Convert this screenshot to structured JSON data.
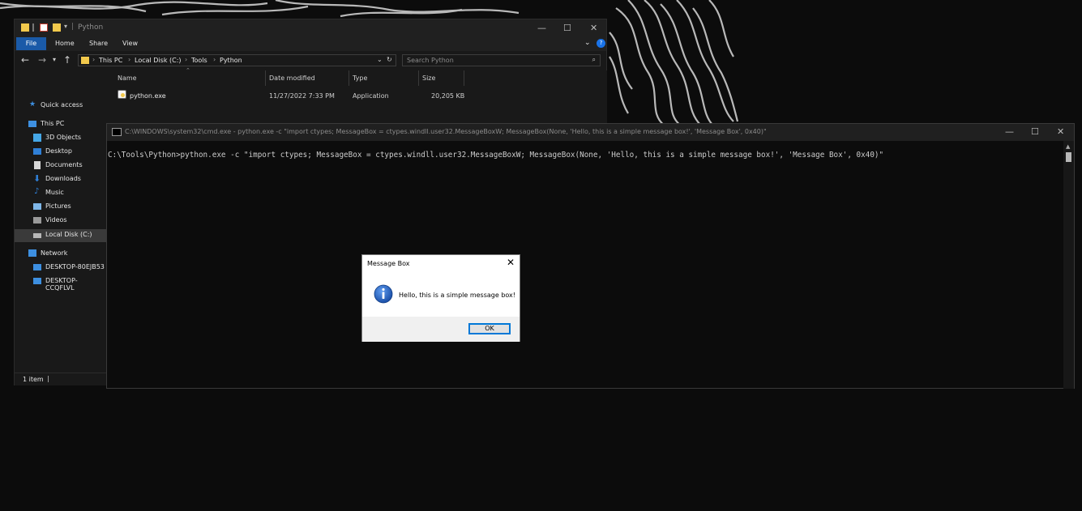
{
  "explorer": {
    "title": "Python",
    "ribbon_tabs": [
      "File",
      "Home",
      "Share",
      "View"
    ],
    "breadcrumbs": [
      "This PC",
      "Local Disk (C:)",
      "Tools",
      "Python"
    ],
    "search_placeholder": "Search Python",
    "nav": {
      "quick_access": "Quick access",
      "this_pc": "This PC",
      "objects3d": "3D Objects",
      "desktop": "Desktop",
      "documents": "Documents",
      "downloads": "Downloads",
      "music": "Music",
      "pictures": "Pictures",
      "videos": "Videos",
      "local_disk": "Local Disk (C:)",
      "network": "Network",
      "pc1": "DESKTOP-80EJB53",
      "pc2": "DESKTOP-CCQFLVL"
    },
    "columns": [
      "Name",
      "Date modified",
      "Type",
      "Size"
    ],
    "files": [
      {
        "name": "python.exe",
        "date": "11/27/2022 7:33 PM",
        "type": "Application",
        "size": "20,205 KB"
      }
    ],
    "status": "1 item"
  },
  "cmd": {
    "title": "C:\\WINDOWS\\system32\\cmd.exe - python.exe  -c \"import ctypes; MessageBox = ctypes.windll.user32.MessageBoxW; MessageBox(None, 'Hello, this is a simple message box!', 'Message Box', 0x40)\"",
    "line": "C:\\Tools\\Python>python.exe -c \"import ctypes; MessageBox = ctypes.windll.user32.MessageBoxW; MessageBox(None, 'Hello, this is a simple message box!', 'Message Box', 0x40)\""
  },
  "msgbox": {
    "title": "Message Box",
    "text": "Hello, this is a simple message box!",
    "ok_label": "OK",
    "icon": "info-icon"
  },
  "colors": {
    "accent": "#1a5aa8",
    "ok_border": "#0078d7",
    "info_blue": "#1e5bb5"
  }
}
